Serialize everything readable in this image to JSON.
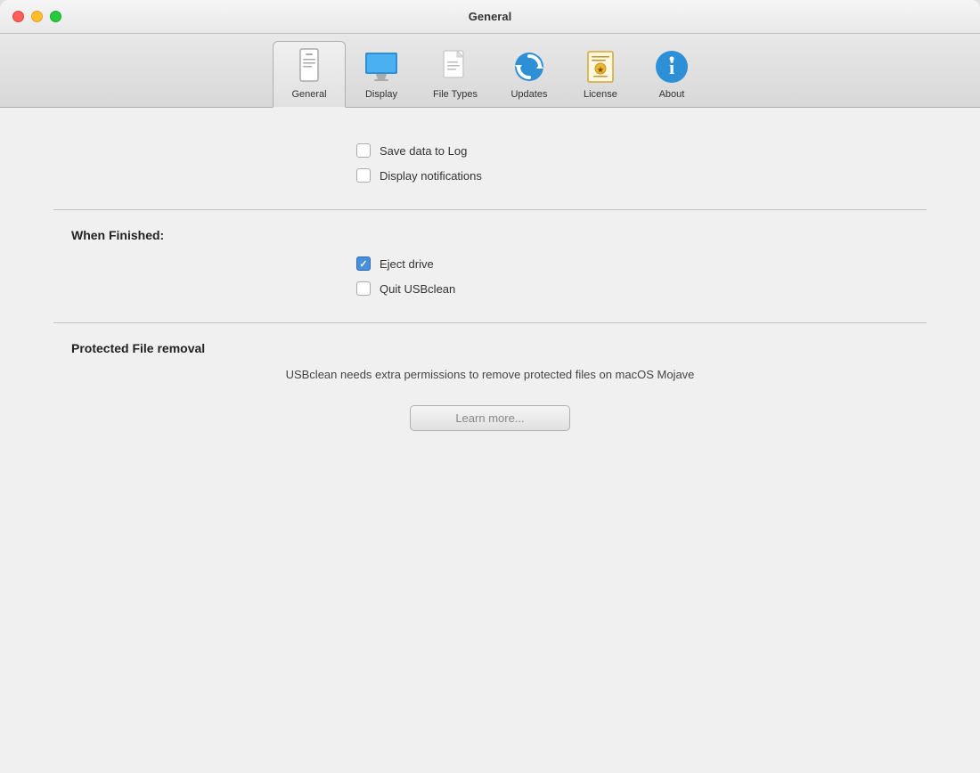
{
  "window": {
    "title": "General"
  },
  "toolbar": {
    "items": [
      {
        "id": "general",
        "label": "General",
        "active": true
      },
      {
        "id": "display",
        "label": "Display",
        "active": false
      },
      {
        "id": "filetypes",
        "label": "File Types",
        "active": false
      },
      {
        "id": "updates",
        "label": "Updates",
        "active": false
      },
      {
        "id": "license",
        "label": "License",
        "active": false
      },
      {
        "id": "about",
        "label": "About",
        "active": false
      }
    ]
  },
  "general": {
    "options": {
      "save_data_to_log": {
        "label": "Save data to Log",
        "checked": false
      },
      "display_notifications": {
        "label": "Display notifications",
        "checked": false
      }
    },
    "when_finished": {
      "title": "When Finished:",
      "eject_drive": {
        "label": "Eject drive",
        "checked": true
      },
      "quit_usbclean": {
        "label": "Quit USBclean",
        "checked": false
      }
    },
    "protected_file_removal": {
      "title": "Protected File removal",
      "description": "USBclean needs extra permissions to remove protected files on macOS Mojave",
      "learn_more_label": "Learn more..."
    }
  }
}
